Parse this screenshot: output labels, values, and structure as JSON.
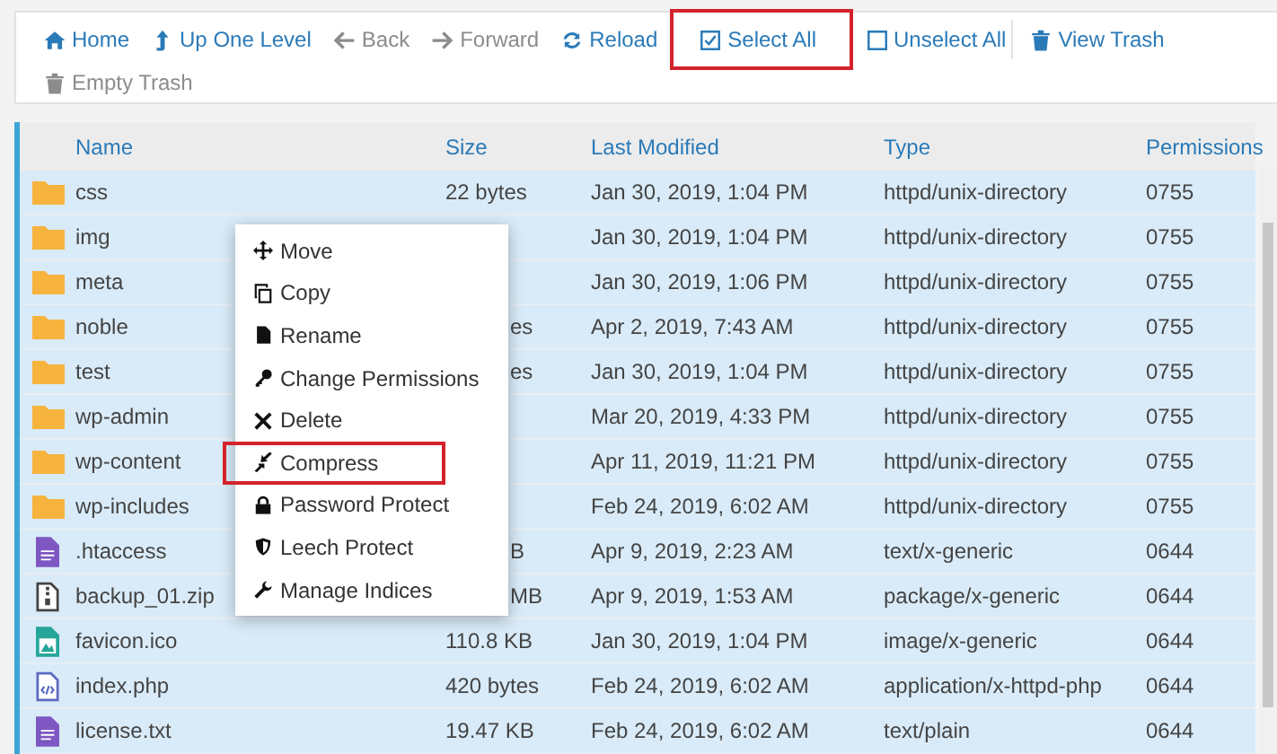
{
  "toolbar": [
    {
      "label": "Home",
      "disabled": false,
      "highlighted": false
    },
    {
      "label": "Up One Level",
      "disabled": false,
      "highlighted": false
    },
    {
      "label": "Back",
      "disabled": true,
      "highlighted": false
    },
    {
      "label": "Forward",
      "disabled": true,
      "highlighted": false
    },
    {
      "label": "Reload",
      "disabled": false,
      "highlighted": false
    },
    {
      "label": "Select All",
      "disabled": false,
      "highlighted": true
    },
    {
      "label": "Unselect All",
      "disabled": false,
      "highlighted": false
    },
    {
      "label": "View Trash",
      "disabled": false,
      "highlighted": false
    },
    {
      "label": "Empty Trash",
      "disabled": true,
      "highlighted": false
    }
  ],
  "table": {
    "columns": [
      "Name",
      "Size",
      "Last Modified",
      "Type",
      "Permissions"
    ],
    "rows": [
      {
        "kind": "folder",
        "name": "css",
        "size": "22 bytes",
        "size_clipped": false,
        "modified": "Jan 30, 2019, 1:04 PM",
        "type": "httpd/unix-directory",
        "permissions": "0755",
        "selected": true
      },
      {
        "kind": "folder",
        "name": "img",
        "modified": "Jan 30, 2019, 1:04 PM",
        "type": "httpd/unix-directory",
        "permissions": "0755",
        "selected": true
      },
      {
        "kind": "folder",
        "name": "meta",
        "modified": "Jan 30, 2019, 1:06 PM",
        "type": "httpd/unix-directory",
        "permissions": "0755",
        "selected": true
      },
      {
        "kind": "folder",
        "name": "noble",
        "size": "es",
        "size_clipped": true,
        "modified": "Apr 2, 2019, 7:43 AM",
        "type": "httpd/unix-directory",
        "permissions": "0755",
        "selected": true
      },
      {
        "kind": "folder",
        "name": "test",
        "size": "es",
        "size_clipped": true,
        "modified": "Jan 30, 2019, 1:04 PM",
        "type": "httpd/unix-directory",
        "permissions": "0755",
        "selected": true
      },
      {
        "kind": "folder",
        "name": "wp-admin",
        "modified": "Mar 20, 2019, 4:33 PM",
        "type": "httpd/unix-directory",
        "permissions": "0755",
        "selected": true
      },
      {
        "kind": "folder",
        "name": "wp-content",
        "modified": "Apr 11, 2019, 11:21 PM",
        "type": "httpd/unix-directory",
        "permissions": "0755",
        "selected": true
      },
      {
        "kind": "folder",
        "name": "wp-includes",
        "modified": "Feb 24, 2019, 6:02 AM",
        "type": "httpd/unix-directory",
        "permissions": "0755",
        "selected": true
      },
      {
        "kind": "text",
        "name": ".htaccess",
        "size": "B",
        "size_clipped": true,
        "modified": "Apr 9, 2019, 2:23 AM",
        "type": "text/x-generic",
        "permissions": "0644",
        "selected": true
      },
      {
        "kind": "archive",
        "name": "backup_01.zip",
        "size": "MB",
        "size_clipped": true,
        "modified": "Apr 9, 2019, 1:53 AM",
        "type": "package/x-generic",
        "permissions": "0644",
        "selected": true
      },
      {
        "kind": "image",
        "name": "favicon.ico",
        "size": "110.8 KB",
        "size_clipped": false,
        "modified": "Jan 30, 2019, 1:04 PM",
        "type": "image/x-generic",
        "permissions": "0644",
        "selected": true
      },
      {
        "kind": "code",
        "name": "index.php",
        "size": "420 bytes",
        "size_clipped": false,
        "modified": "Feb 24, 2019, 6:02 AM",
        "type": "application/x-httpd-php",
        "permissions": "0644",
        "selected": true
      },
      {
        "kind": "text",
        "name": "license.txt",
        "size": "19.47 KB",
        "size_clipped": false,
        "modified": "Feb 24, 2019, 6:02 AM",
        "type": "text/plain",
        "permissions": "0644",
        "selected": true
      }
    ]
  },
  "context_menu": [
    {
      "label": "Move",
      "highlighted": false
    },
    {
      "label": "Copy",
      "highlighted": false
    },
    {
      "label": "Rename",
      "highlighted": false
    },
    {
      "label": "Change Permissions",
      "highlighted": false
    },
    {
      "label": "Delete",
      "highlighted": false
    },
    {
      "label": "Compress",
      "highlighted": true
    },
    {
      "label": "Password Protect",
      "highlighted": false
    },
    {
      "label": "Leech Protect",
      "highlighted": false
    },
    {
      "label": "Manage Indices",
      "highlighted": false
    }
  ]
}
